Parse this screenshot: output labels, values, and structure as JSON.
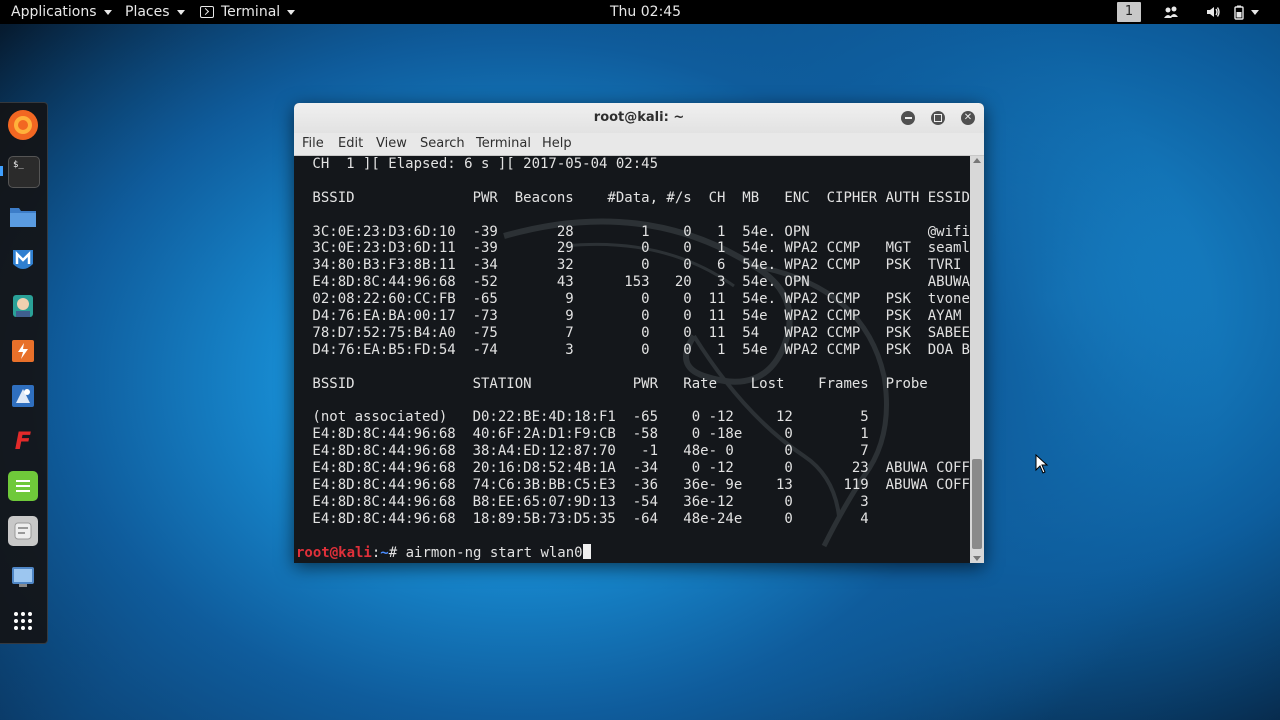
{
  "topbar": {
    "applications_label": "Applications",
    "places_label": "Places",
    "terminal_label": "Terminal",
    "clock": "Thu 02:45",
    "workspace_number": "1",
    "icons": [
      "users-icon",
      "volume-icon",
      "battery-icon",
      "power-caret-icon"
    ]
  },
  "dock": {
    "items": [
      {
        "name": "firefox-icon",
        "color": "#f26722"
      },
      {
        "name": "terminal-icon",
        "color": "#2b2b2b"
      },
      {
        "name": "files-icon",
        "color": "#4a8fd8"
      },
      {
        "name": "metasploit-icon",
        "color": "#2f7fd0"
      },
      {
        "name": "armitage-icon",
        "color": "#2aa198"
      },
      {
        "name": "burpsuite-icon",
        "color": "#e8702a"
      },
      {
        "name": "beef-icon",
        "color": "#2f6fbf"
      },
      {
        "name": "faraday-icon",
        "color": "#e22a2a"
      },
      {
        "name": "leafpad-icon",
        "color": "#6fc93a"
      },
      {
        "name": "cherrytree-icon",
        "color": "#b0b0b0"
      },
      {
        "name": "screenshot-icon",
        "color": "#4f86c6"
      },
      {
        "name": "show-apps-icon",
        "color": "#ffffff"
      }
    ]
  },
  "window": {
    "title": "root@kali: ~",
    "menu": [
      "File",
      "Edit",
      "View",
      "Search",
      "Terminal",
      "Help"
    ]
  },
  "terminal": {
    "lines": [
      " CH  1 ][ Elapsed: 6 s ][ 2017-05-04 02:45",
      "",
      " BSSID              PWR  Beacons    #Data, #/s  CH  MB   ENC  CIPHER AUTH ESSID",
      "",
      " 3C:0E:23:D3:6D:10  -39       28        1    0   1  54e. OPN              @wifi",
      " 3C:0E:23:D3:6D:11  -39       29        0    0   1  54e. WPA2 CCMP   MGT  seaml",
      " 34:80:B3:F3:8B:11  -34       32        0    0   6  54e. WPA2 CCMP   PSK  TVRI",
      " E4:8D:8C:44:96:68  -52       43      153   20   3  54e. OPN              ABUWA",
      " 02:08:22:60:CC:FB  -65        9        0    0  11  54e. WPA2 CCMP   PSK  tvone",
      " D4:76:EA:BA:00:17  -73        9        0    0  11  54e  WPA2 CCMP   PSK  AYAM",
      " 78:D7:52:75:B4:A0  -75        7        0    0  11  54   WPA2 CCMP   PSK  SABEE",
      " D4:76:EA:B5:FD:54  -74        3        0    0   1  54e  WPA2 CCMP   PSK  DOA B",
      "",
      " BSSID              STATION            PWR   Rate    Lost    Frames  Probe",
      "",
      " (not associated)   D0:22:BE:4D:18:F1  -65    0 -12     12        5",
      " E4:8D:8C:44:96:68  40:6F:2A:D1:F9:CB  -58    0 -18e     0        1",
      " E4:8D:8C:44:96:68  38:A4:ED:12:87:70   -1   48e- 0      0        7",
      " E4:8D:8C:44:96:68  20:16:D8:52:4B:1A  -34    0 -12      0       23  ABUWA COFFE",
      " E4:8D:8C:44:96:68  74:C6:3B:BB:C5:E3  -36   36e- 9e    13      119  ABUWA COFFE",
      " E4:8D:8C:44:96:68  B8:EE:65:07:9D:13  -54   36e-12      0        3",
      " E4:8D:8C:44:96:68  18:89:5B:73:D5:35  -64   48e-24e     0        4"
    ],
    "prompt_user": "root@kali",
    "prompt_sep": ":",
    "prompt_path": "~",
    "prompt_symbol": "# ",
    "command": "airmon-ng start wlan0"
  },
  "colors": {
    "prompt_user": "#e0303a",
    "prompt_path": "#4a8cff",
    "terminal_bg": "#14171b",
    "terminal_fg": "#e2e2e2"
  }
}
